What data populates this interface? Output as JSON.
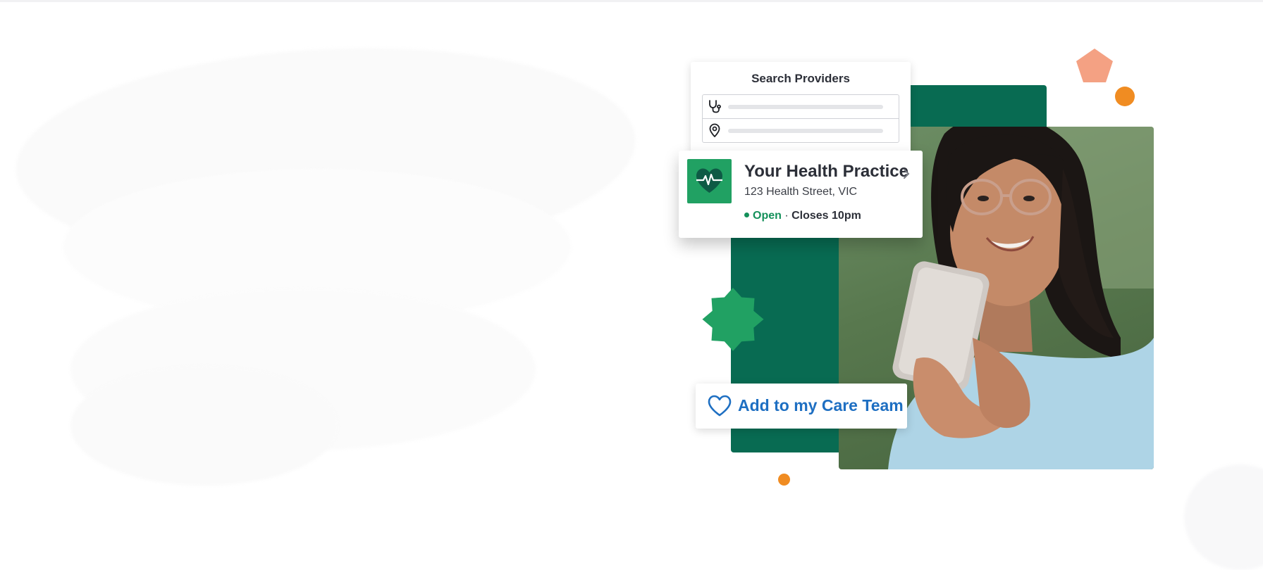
{
  "search": {
    "title": "Search Providers",
    "fields": [
      {
        "icon": "stethoscope-icon",
        "placeholder": ""
      },
      {
        "icon": "location-pin-icon",
        "placeholder": ""
      }
    ]
  },
  "practice": {
    "logo_icon": "heart-pulse-icon",
    "name": "Your Health Practice",
    "address": "123 Health Street, VIC",
    "status": "Open",
    "separator": " · ",
    "hours": "Closes 10pm",
    "chevron_icon": "chevron-right-icon"
  },
  "care_team": {
    "icon": "heart-outline-icon",
    "label": "Add to my Care Team"
  },
  "colors": {
    "brand_green": "#086b52",
    "accent_green": "#21a163",
    "open_green": "#14905a",
    "orange": "#f08c22",
    "salmon": "#f4a183",
    "link_blue": "#1e6fc2",
    "text_dark": "#2c2f38"
  }
}
